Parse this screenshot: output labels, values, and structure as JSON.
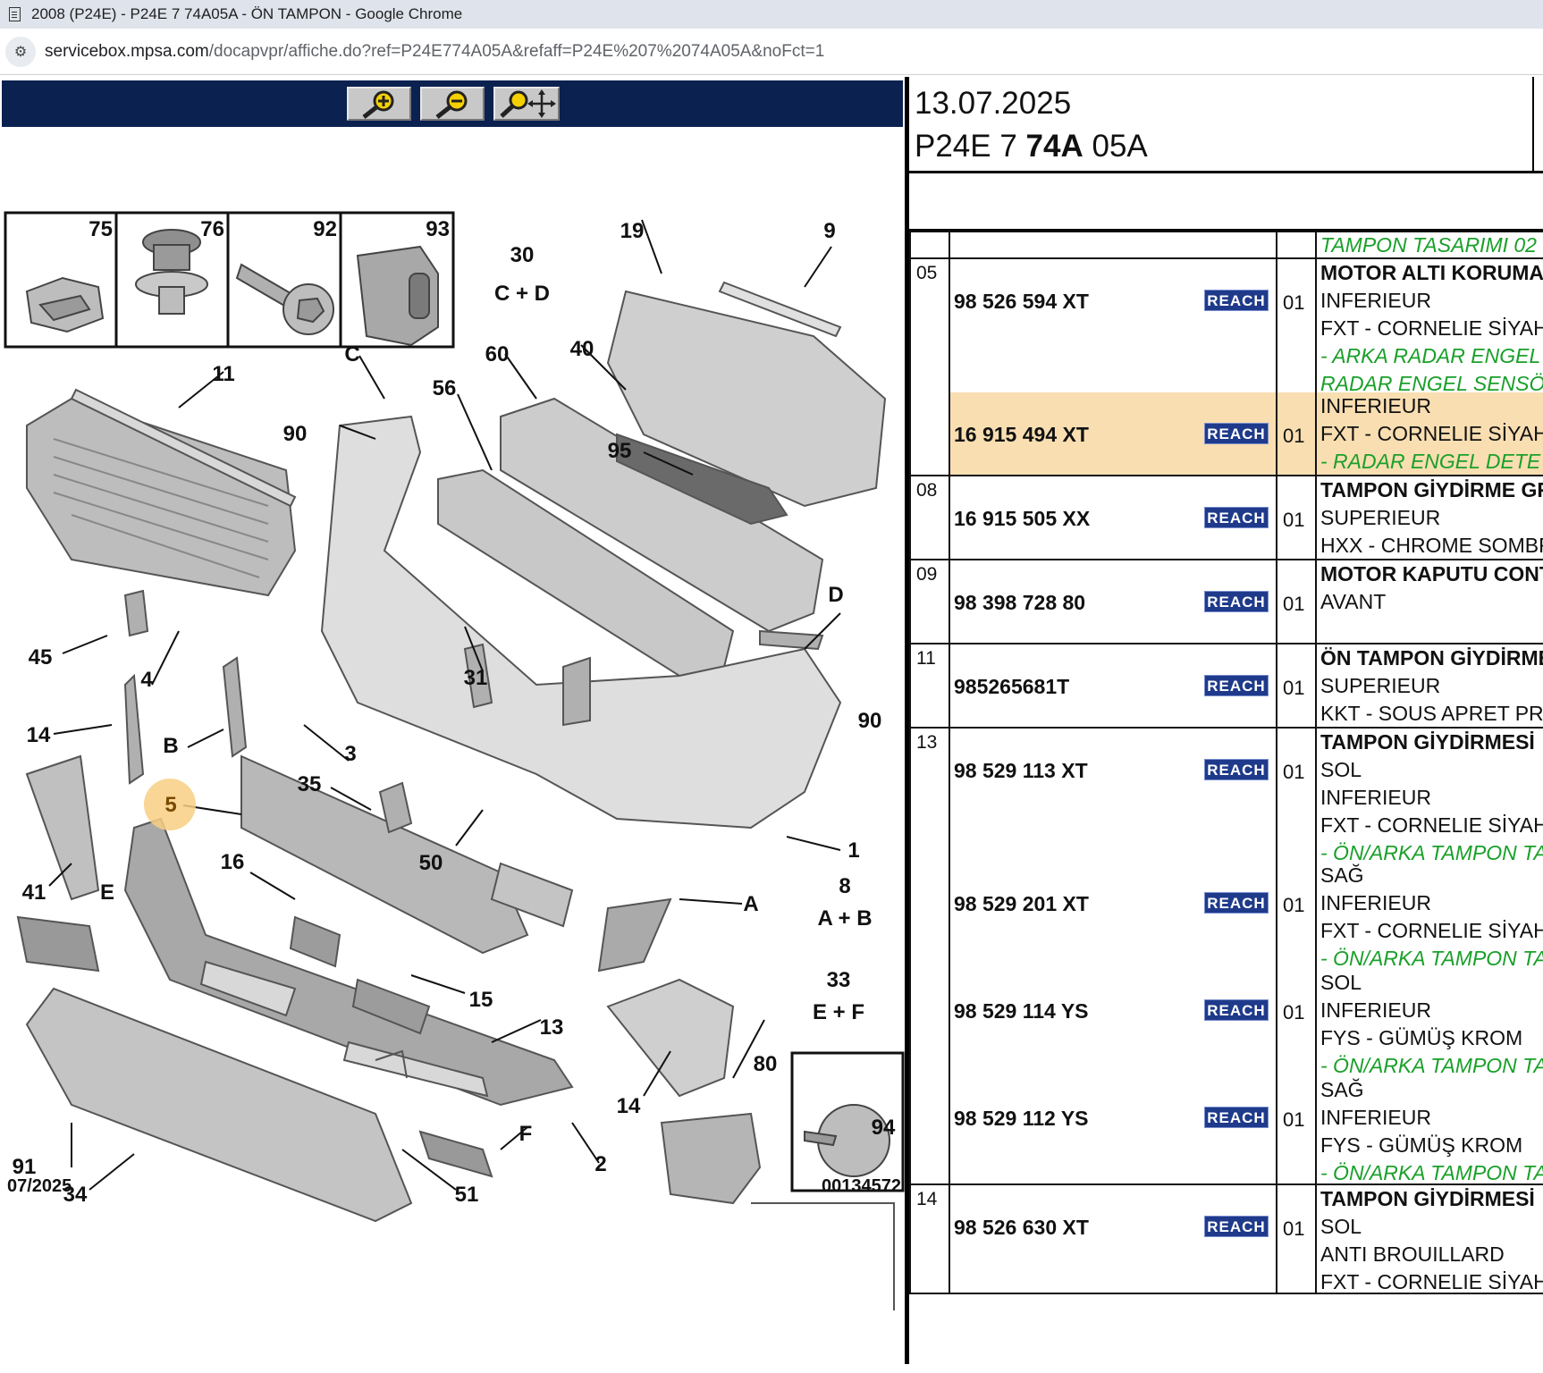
{
  "window": {
    "title": "2008 (P24E) - P24E 7 74A05A - ÖN TAMPON - Google Chrome",
    "url_host": "servicebox.mpsa.com",
    "url_path": "/docapvpr/affiche.do?ref=P24E774A05A&refaff=P24E%207%2074A05A&noFct=1"
  },
  "toolbar": {
    "zoom_in_icon": "zoom-in-icon",
    "zoom_out_icon": "zoom-out-icon",
    "pan_icon": "zoom-pan-icon"
  },
  "diagram": {
    "inset_labels": [
      "75",
      "76",
      "92",
      "93"
    ],
    "date_code": "07/2025",
    "doc_code": "00134572",
    "highlighted_callout": "5",
    "callouts": [
      "19",
      "9",
      "30",
      "C + D",
      "C",
      "60",
      "40",
      "11",
      "56",
      "90",
      "95",
      "45",
      "D",
      "4",
      "31",
      "90",
      "14",
      "B",
      "3",
      "1",
      "5",
      "35",
      "50",
      "8",
      "A + B",
      "41",
      "E",
      "16",
      "A",
      "33",
      "E + F",
      "15",
      "13",
      "80",
      "14",
      "94",
      "91",
      "F",
      "2",
      "34",
      "51"
    ]
  },
  "header": {
    "date": "13.07.2025",
    "ref_prefix": "P24E 7 ",
    "ref_bold": "74A",
    "ref_suffix": " 05A"
  },
  "table": {
    "top_note": "TAMPON TASARIMI 02",
    "reach_label": "REACH",
    "groups": [
      {
        "ref": "05",
        "title": "MOTOR ALTI KORUMA",
        "items": [
          {
            "part": "98 526 594 XT",
            "qty": "01",
            "lines": [
              "INFERIEUR",
              "FXT - CORNELIE SİYAH"
            ],
            "notes": [
              "- ARKA RADAR ENGEL",
              "RADAR ENGEL SENSÖ"
            ],
            "highlight": false
          },
          {
            "part": "16 915 494 XT",
            "qty": "01",
            "lines": [
              "INFERIEUR",
              "FXT - CORNELIE SİYAH"
            ],
            "notes": [
              "- RADAR ENGEL DETE"
            ],
            "highlight": true
          }
        ]
      },
      {
        "ref": "08",
        "title": "TAMPON GİYDİRME GR",
        "items": [
          {
            "part": "16 915 505 XX",
            "qty": "01",
            "lines": [
              "SUPERIEUR",
              "HXX - CHROME SOMBR"
            ],
            "notes": [],
            "highlight": false
          }
        ]
      },
      {
        "ref": "09",
        "title": "MOTOR KAPUTU CONT",
        "items": [
          {
            "part": "98 398 728 80",
            "qty": "01",
            "lines": [
              "AVANT"
            ],
            "notes": [],
            "highlight": false
          }
        ]
      },
      {
        "ref": "11",
        "title": "ÖN TAMPON GİYDİRME",
        "items": [
          {
            "part": "985265681T",
            "qty": "01",
            "lines": [
              "SUPERIEUR",
              "KKT - SOUS APRET PR"
            ],
            "notes": [],
            "highlight": false
          }
        ]
      },
      {
        "ref": "13",
        "title": "TAMPON GİYDİRMESİ",
        "items": [
          {
            "part": "98 529 113 XT",
            "qty": "01",
            "lines": [
              "SOL",
              "INFERIEUR",
              "FXT - CORNELIE SİYAH"
            ],
            "notes": [
              "- ÖN/ARKA TAMPON TA"
            ],
            "highlight": false
          },
          {
            "part": "98 529 201 XT",
            "qty": "01",
            "lines": [
              "SAĞ",
              "INFERIEUR",
              "FXT - CORNELIE SİYAH"
            ],
            "notes": [
              "- ÖN/ARKA TAMPON TA"
            ],
            "highlight": false
          },
          {
            "part": "98 529 114 YS",
            "qty": "01",
            "lines": [
              "SOL",
              "INFERIEUR",
              "FYS - GÜMÜŞ KROM"
            ],
            "notes": [
              "- ÖN/ARKA TAMPON TA"
            ],
            "highlight": false
          },
          {
            "part": "98 529 112 YS",
            "qty": "01",
            "lines": [
              "SAĞ",
              "INFERIEUR",
              "FYS - GÜMÜŞ KROM"
            ],
            "notes": [
              "- ÖN/ARKA TAMPON TA"
            ],
            "highlight": false
          }
        ]
      },
      {
        "ref": "14",
        "title": "TAMPON GİYDİRMESİ",
        "items": [
          {
            "part": "98 526 630 XT",
            "qty": "01",
            "lines": [
              "SOL",
              "ANTI BROUILLARD",
              "FXT - CORNELIE SİYAH"
            ],
            "notes": [],
            "highlight": false
          }
        ]
      }
    ]
  }
}
